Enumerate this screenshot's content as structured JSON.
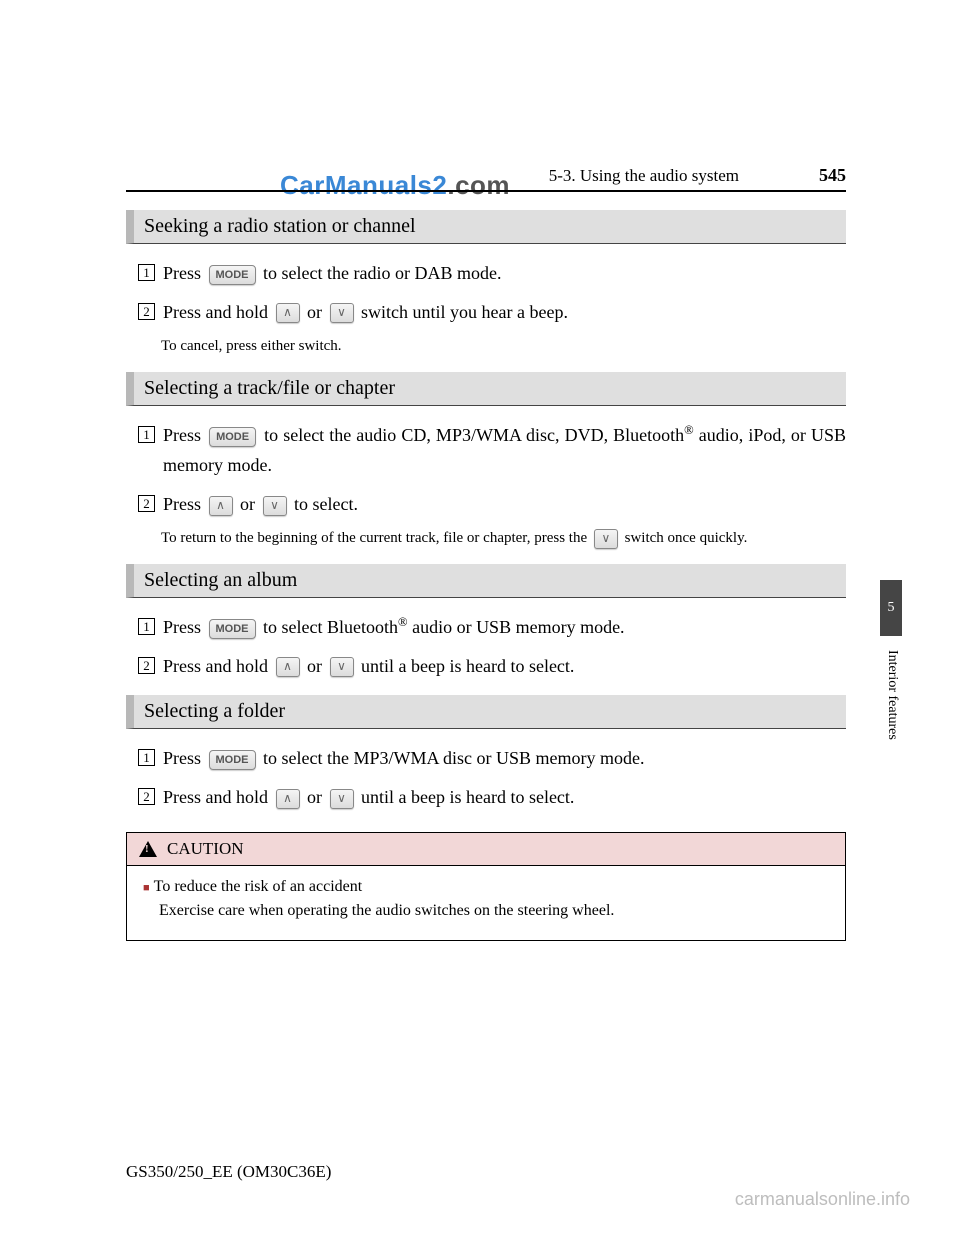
{
  "header": {
    "section": "5-3. Using the audio system",
    "page": "545"
  },
  "watermark": {
    "part1": "CarManuals2",
    "part2": ".com"
  },
  "side": {
    "chapter": "5",
    "label": "Interior features"
  },
  "buttons": {
    "mode": "MODE",
    "up": "∧",
    "down": "∨"
  },
  "sections": {
    "radio": {
      "title": "Seeking a radio station or channel",
      "step1_a": "Press ",
      "step1_b": " to select the radio or DAB mode.",
      "step2_a": "Press and hold ",
      "step2_b": " or ",
      "step2_c": " switch until you hear a beep.",
      "sub": "To cancel, press either switch."
    },
    "track": {
      "title": "Selecting a track/file or chapter",
      "step1_a": "Press ",
      "step1_b": " to select the audio CD, MP3/WMA disc, DVD, Bluetooth",
      "step1_c": " audio, iPod, or USB memory mode.",
      "step2_a": "Press ",
      "step2_b": " or ",
      "step2_c": " to select.",
      "sub_a": "To return to the beginning of the current track, file or chapter, press the ",
      "sub_b": " switch once quickly."
    },
    "album": {
      "title": "Selecting an album",
      "step1_a": "Press ",
      "step1_b": " to select Bluetooth",
      "step1_c": " audio or USB memory mode.",
      "step2_a": "Press and hold ",
      "step2_b": " or ",
      "step2_c": " until a beep is heard to select."
    },
    "folder": {
      "title": "Selecting a folder",
      "step1_a": "Press ",
      "step1_b": " to select the MP3/WMA disc or USB memory mode.",
      "step2_a": "Press and hold ",
      "step2_b": " or ",
      "step2_c": " until a beep is heard to select."
    }
  },
  "caution": {
    "label": "CAUTION",
    "title": "To reduce the risk of an accident",
    "body": "Exercise care when operating the audio switches on the steering wheel."
  },
  "footer": {
    "doc": "GS350/250_EE (OM30C36E)",
    "url": "carmanualsonline.info"
  }
}
